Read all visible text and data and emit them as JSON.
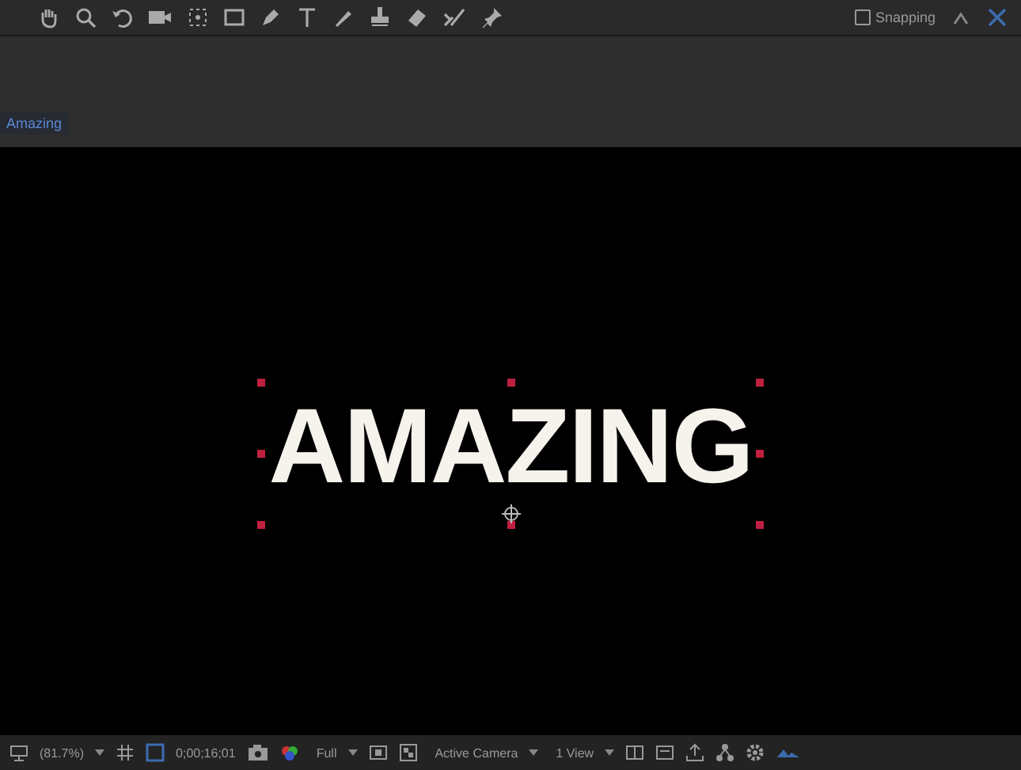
{
  "toolbar": {
    "snapping": {
      "label": "Snapping",
      "checked": false
    }
  },
  "composition_tab": {
    "label": "Amazing",
    "selected": true
  },
  "viewer": {
    "text": "AMAZING",
    "selected": true
  },
  "viewer_bar": {
    "zoom": "(81.7%)",
    "timecode": "0;00;16;01",
    "resolution": "Full",
    "camera": "Active Camera",
    "views": "1 View"
  }
}
